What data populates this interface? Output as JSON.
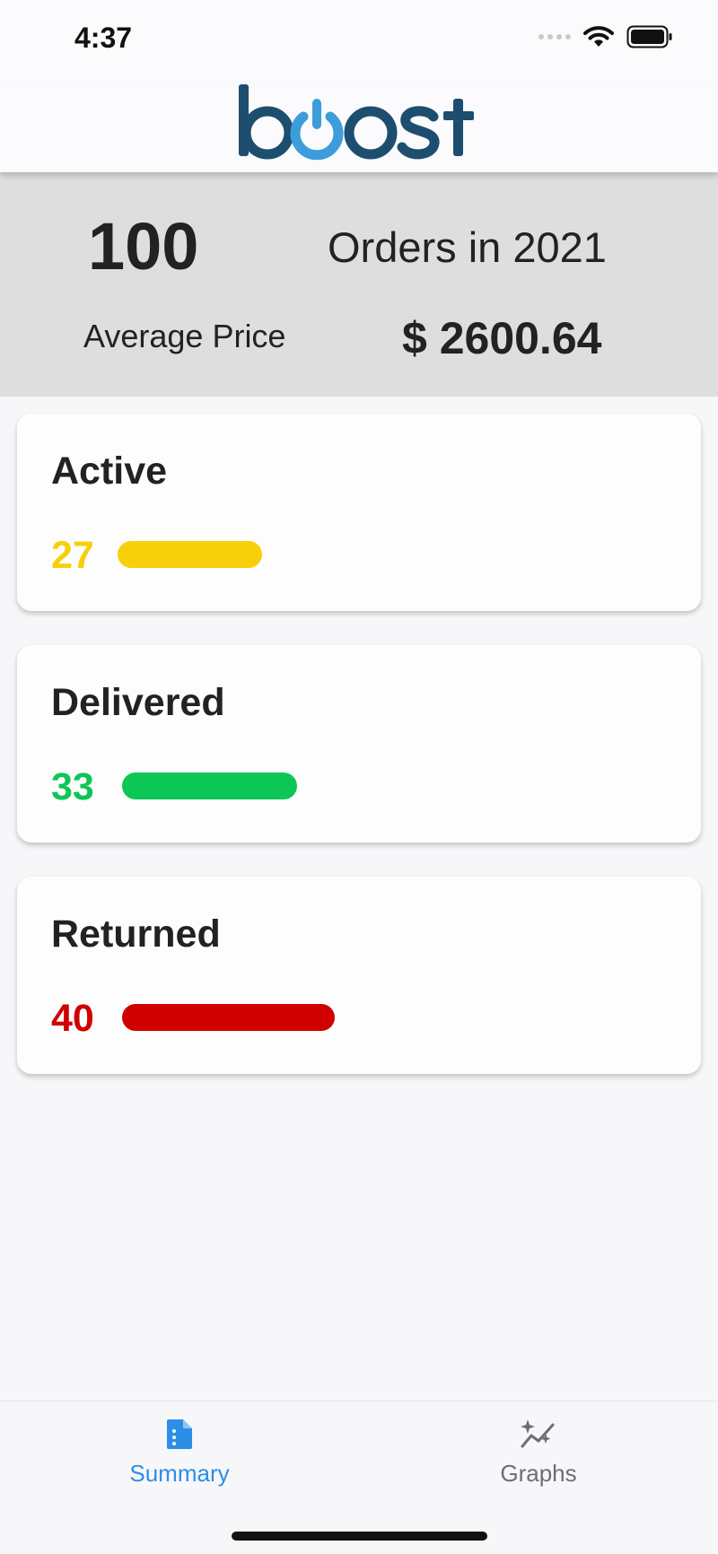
{
  "status_bar": {
    "time": "4:37",
    "icons": [
      "signal-dots-icon",
      "wifi-icon",
      "battery-icon"
    ]
  },
  "header": {
    "logo_text": "boost",
    "colors": {
      "logo_dark": "#1d4e6f",
      "logo_accent": "#3d9ddb"
    }
  },
  "summary": {
    "orders_count": "100",
    "orders_label": "Orders in 2021",
    "average_label": "Average Price",
    "average_value": "$ 2600.64"
  },
  "cards": [
    {
      "title": "Active",
      "count": "27",
      "color": "#f7cf0b",
      "share": 0.27
    },
    {
      "title": "Delivered",
      "count": "33",
      "color": "#0cc655",
      "share": 0.33
    },
    {
      "title": "Returned",
      "count": "40",
      "color": "#d10000",
      "share": 0.4
    }
  ],
  "tabs": [
    {
      "label": "Summary",
      "icon": "document-icon",
      "active": true,
      "color": "#2d8ee8"
    },
    {
      "label": "Graphs",
      "icon": "sparkle-chart-icon",
      "active": false,
      "color": "#6e6e72"
    }
  ]
}
